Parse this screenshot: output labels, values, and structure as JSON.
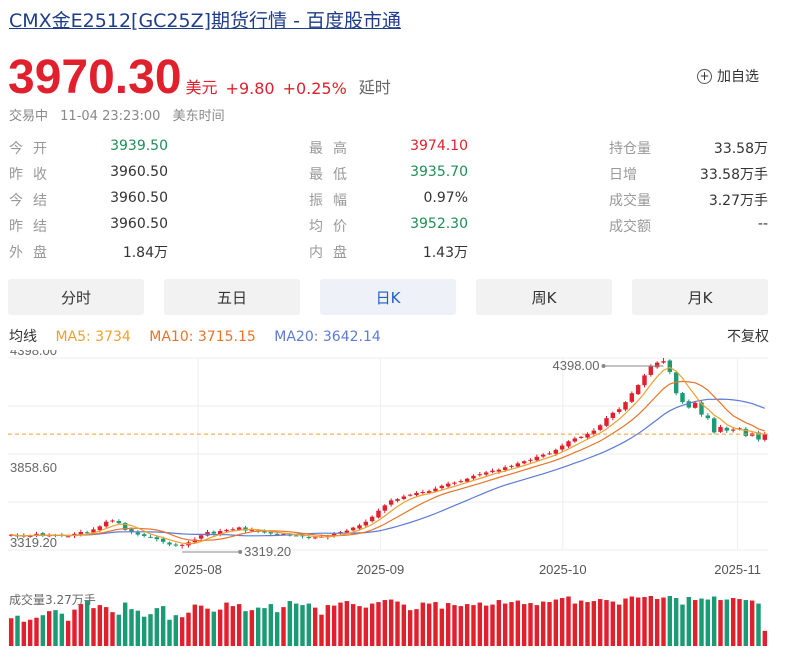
{
  "header": {
    "title": "CMX金E2512[GC25Z]期货行情 - 百度股市通",
    "price": "3970.30",
    "currency": "美元",
    "change": "+9.80",
    "change_pct": "+0.25%",
    "delay": "延时",
    "add_watch": "加自选",
    "status": "交易中",
    "time": "11-04 23:23:00",
    "timezone": "美东时间"
  },
  "quotes": {
    "col1": [
      {
        "label": "今开",
        "value": "3939.50",
        "color": "green"
      },
      {
        "label": "昨收",
        "value": "3960.50",
        "color": "dark"
      },
      {
        "label": "今结",
        "value": "3960.50",
        "color": "dark"
      },
      {
        "label": "昨结",
        "value": "3960.50",
        "color": "dark"
      },
      {
        "label": "外盘",
        "value": "1.84万",
        "color": "dark"
      }
    ],
    "col2": [
      {
        "label": "最高",
        "value": "3974.10",
        "color": "red"
      },
      {
        "label": "最低",
        "value": "3935.70",
        "color": "green"
      },
      {
        "label": "振幅",
        "value": "0.97%",
        "color": "dark"
      },
      {
        "label": "均价",
        "value": "3952.30",
        "color": "green"
      },
      {
        "label": "内盘",
        "value": "1.43万",
        "color": "dark"
      }
    ],
    "col3": [
      {
        "label": "持仓量",
        "value": "33.58万",
        "color": "dark"
      },
      {
        "label": "日增",
        "value": "33.58万手",
        "color": "dark"
      },
      {
        "label": "成交量",
        "value": "3.27万手",
        "color": "dark"
      },
      {
        "label": "成交额",
        "value": "--",
        "color": "dark"
      }
    ]
  },
  "tabs": [
    {
      "label": "分时",
      "active": false
    },
    {
      "label": "五日",
      "active": false
    },
    {
      "label": "日K",
      "active": true
    },
    {
      "label": "周K",
      "active": false
    },
    {
      "label": "月K",
      "active": false
    }
  ],
  "ma": {
    "label": "均线",
    "ma5": "MA5: 3734",
    "ma10": "MA10: 3715.15",
    "ma20": "MA20: 3642.14",
    "adjust": "不复权"
  },
  "volume_label": "成交量3.27万手",
  "colors": {
    "up": "#e0212d",
    "down": "#1a9b73",
    "ma5": "#f0a030",
    "ma10": "#e8742a",
    "ma20": "#5b7bd5",
    "accent": "#1f5fcc"
  },
  "chart_data": {
    "type": "candlestick",
    "y_labels": [
      "4398.00",
      "3858.60",
      "3319.20"
    ],
    "ylim": [
      3319.2,
      4398.0
    ],
    "current_price": 3970.3,
    "max_annotation": "4398.00",
    "min_annotation": "3319.20",
    "x_labels": [
      "2025-08",
      "2025-09",
      "2025-10",
      "2025-11"
    ],
    "closes": [
      3405,
      3395,
      3400,
      3398,
      3410,
      3405,
      3402,
      3400,
      3398,
      3396,
      3410,
      3420,
      3415,
      3435,
      3452,
      3478,
      3485,
      3470,
      3432,
      3420,
      3406,
      3398,
      3392,
      3380,
      3365,
      3350,
      3344,
      3348,
      3362,
      3378,
      3402,
      3420,
      3412,
      3426,
      3432,
      3436,
      3446,
      3428,
      3432,
      3422,
      3418,
      3412,
      3408,
      3410,
      3402,
      3400,
      3396,
      3388,
      3390,
      3394,
      3398,
      3410,
      3420,
      3428,
      3445,
      3458,
      3478,
      3506,
      3540,
      3570,
      3598,
      3605,
      3620,
      3630,
      3640,
      3645,
      3650,
      3664,
      3680,
      3692,
      3698,
      3706,
      3720,
      3736,
      3745,
      3755,
      3765,
      3770,
      3784,
      3792,
      3806,
      3818,
      3826,
      3843,
      3855,
      3862,
      3882,
      3906,
      3930,
      3946,
      3955,
      3972,
      3990,
      4020,
      4060,
      4090,
      4110,
      4150,
      4200,
      4246,
      4300,
      4350,
      4372,
      4380,
      4320,
      4200,
      4150,
      4120,
      4146,
      4080,
      4060,
      3980,
      4010,
      3990,
      3996,
      4003,
      3960,
      3975,
      3940,
      3970
    ],
    "volumes": [
      5.5,
      6.0,
      4.8,
      5.2,
      5.6,
      6.1,
      6.9,
      7.1,
      6.4,
      5.0,
      7.2,
      8.3,
      8.9,
      7.5,
      8.1,
      7.7,
      6.7,
      6.2,
      8.6,
      7.3,
      7.0,
      5.8,
      6.3,
      7.5,
      7.9,
      5.2,
      6.1,
      5.7,
      6.6,
      8.2,
      8.0,
      7.4,
      6.8,
      7.2,
      8.6,
      7.9,
      8.3,
      6.9,
      7.1,
      7.6,
      7.5,
      8.3,
      6.7,
      7.7,
      8.9,
      8.4,
      8.1,
      8.4,
      7.6,
      6.2,
      8.1,
      8.0,
      8.6,
      8.9,
      8.3,
      7.9,
      7.6,
      8.4,
      8.7,
      9.1,
      9.2,
      8.8,
      8.2,
      7.1,
      7.3,
      8.6,
      8.4,
      8.7,
      7.4,
      8.5,
      8.1,
      7.9,
      8.3,
      8.1,
      8.6,
      8.0,
      8.2,
      9.1,
      8.4,
      8.7,
      9.0,
      8.3,
      8.5,
      8.1,
      8.8,
      8.7,
      9.2,
      9.5,
      9.8,
      8.4,
      9.0,
      8.7,
      8.9,
      9.3,
      9.1,
      8.8,
      8.2,
      9.4,
      9.8,
      9.6,
      9.7,
      9.9,
      9.3,
      9.6,
      9.9,
      9.5,
      8.2,
      9.7,
      9.1,
      9.4,
      9.2,
      9.8,
      9.1,
      9.2,
      9.5,
      9.3,
      9.1,
      9.0,
      8.4,
      3.0
    ]
  }
}
